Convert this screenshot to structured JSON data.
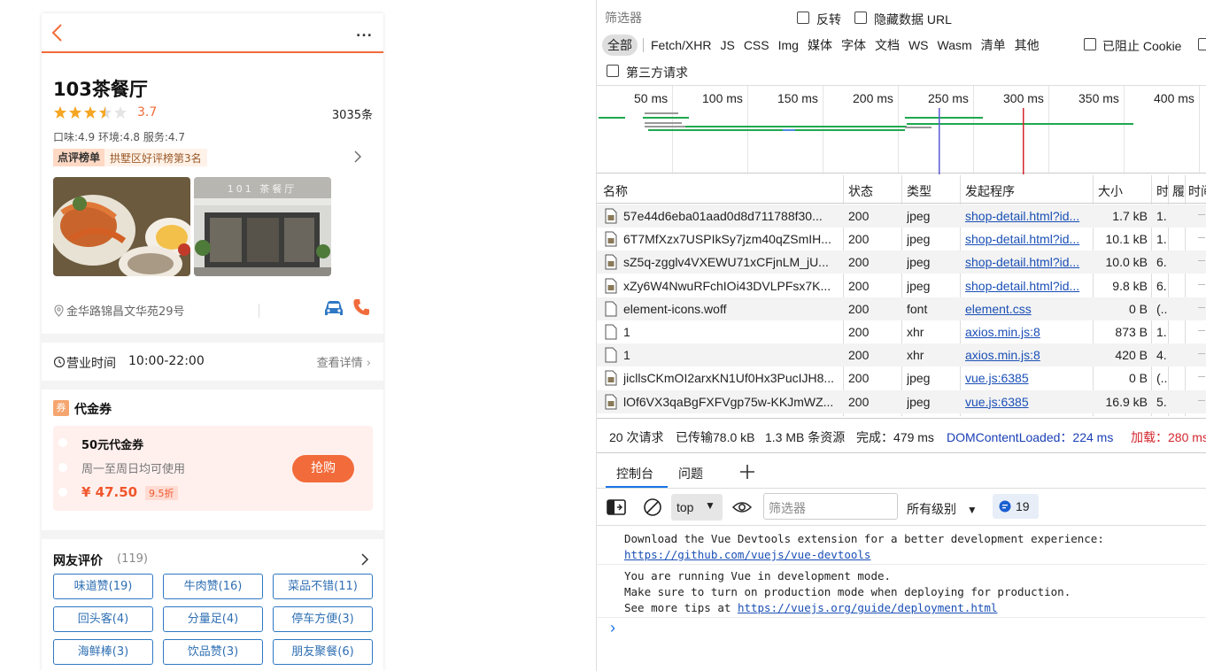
{
  "shop": {
    "name": "103茶餐厅",
    "rating": "3.7",
    "rating_stars": 3.5,
    "review_count": "3035条",
    "sub_scores": "口味:4.9 环境:4.8 服务:4.7",
    "rank_tag": "点评榜单",
    "rank_text": "拱墅区好评榜第3名",
    "photo2_sign": "101 茶餐厅",
    "address": "金华路锦昌文华苑29号",
    "hours_label": "营业时间",
    "hours_value": "10:00-22:00",
    "hours_detail": "查看详情",
    "more": "..."
  },
  "coupon": {
    "badge": "券",
    "section_title": "代金券",
    "name": "50元代金券",
    "desc": "周一至周日均可使用",
    "price": "¥ 47.50",
    "discount": "9.5折",
    "buy_label": "抢购"
  },
  "reviews": {
    "title": "网友评价",
    "count": "(119)",
    "tags": [
      "味道赞(19)",
      "牛肉赞(16)",
      "菜品不错(11)",
      "回头客(4)",
      "分量足(4)",
      "停车方便(3)",
      "海鲜棒(3)",
      "饮品赞(3)",
      "朋友聚餐(6)"
    ]
  },
  "devtools": {
    "filter_placeholder": "筛选器",
    "invert_label": "反转",
    "hide_data_url_label": "隐藏数据 URL",
    "types": [
      "全部",
      "Fetch/XHR",
      "JS",
      "CSS",
      "Img",
      "媒体",
      "字体",
      "文档",
      "WS",
      "Wasm",
      "清单",
      "其他"
    ],
    "blocked_cookie_label": "已阻止 Cookie",
    "third_party_label": "第三方请求",
    "timeline_ticks": [
      "50 ms",
      "100 ms",
      "150 ms",
      "200 ms",
      "250 ms",
      "300 ms",
      "350 ms",
      "400 ms"
    ],
    "columns": [
      "名称",
      "状态",
      "类型",
      "发起程序",
      "大小",
      "时",
      "履",
      "时间"
    ],
    "rows": [
      {
        "name": "57e44d6eba01aad0d8d711788f30...",
        "status": "200",
        "type": "jpeg",
        "initiator": "shop-detail.html?id...",
        "size": "1.7 kB",
        "time": "1.",
        "icon": "image-file-icon"
      },
      {
        "name": "6T7MfXzx7USPIkSy7jzm40qZSmIH...",
        "status": "200",
        "type": "jpeg",
        "initiator": "shop-detail.html?id...",
        "size": "10.1 kB",
        "time": "1.",
        "icon": "image-file-icon"
      },
      {
        "name": "sZ5q-zgglv4VXEWU71xCFjnLM_jU...",
        "status": "200",
        "type": "jpeg",
        "initiator": "shop-detail.html?id...",
        "size": "10.0 kB",
        "time": "6.",
        "icon": "image-file-icon"
      },
      {
        "name": "xZy6W4NwuRFchIOi43DVLPFsx7K...",
        "status": "200",
        "type": "jpeg",
        "initiator": "shop-detail.html?id...",
        "size": "9.8 kB",
        "time": "6.",
        "icon": "image-file-icon"
      },
      {
        "name": "element-icons.woff",
        "status": "200",
        "type": "font",
        "initiator": "element.css",
        "size": "0 B",
        "time": "(..",
        "icon": "document-icon"
      },
      {
        "name": "1",
        "status": "200",
        "type": "xhr",
        "initiator": "axios.min.js:8",
        "size": "873 B",
        "time": "1.",
        "icon": "document-icon"
      },
      {
        "name": "1",
        "status": "200",
        "type": "xhr",
        "initiator": "axios.min.js:8",
        "size": "420 B",
        "time": "4.",
        "icon": "document-icon"
      },
      {
        "name": "jicllsCKmOI2arxKN1Uf0Hx3PucIJH8...",
        "status": "200",
        "type": "jpeg",
        "initiator": "vue.js:6385",
        "size": "0 B",
        "time": "(..",
        "icon": "image-file-icon"
      },
      {
        "name": "lOf6VX3qaBgFXFVgp75w-KKJmWZ...",
        "status": "200",
        "type": "jpeg",
        "initiator": "vue.js:6385",
        "size": "16.9 kB",
        "time": "5.",
        "icon": "image-file-icon"
      }
    ],
    "summary": {
      "requests": "20 次请求",
      "transferred": "已传输78.0 kB",
      "resources": "1.3 MB 条资源",
      "finish": "完成：479 ms",
      "dcl": "DOMContentLoaded：224 ms",
      "load": "加载：280 ms"
    },
    "drawer_tabs": [
      "控制台",
      "问题"
    ],
    "context": "top",
    "console_filter_placeholder": "筛选器",
    "level": "所有级别",
    "message_count": "19",
    "console": {
      "msg1_text": "Download the Vue Devtools extension for a better development experience:",
      "msg1_link": "https://github.com/vuejs/vue-devtools",
      "msg2_line1": "You are running Vue in development mode.",
      "msg2_line2": "Make sure to turn on production mode when deploying for production.",
      "msg2_line3_prefix": "See more tips at ",
      "msg2_link": "https://vuejs.org/guide/deployment.html",
      "prompt": "›"
    }
  },
  "colors": {
    "accent": "#f26b3a",
    "star": "#f5a623",
    "link": "#1a4fb5",
    "dcl": "#1a3fb5",
    "load": "#d3272e",
    "tag_border": "#2f78c4"
  }
}
